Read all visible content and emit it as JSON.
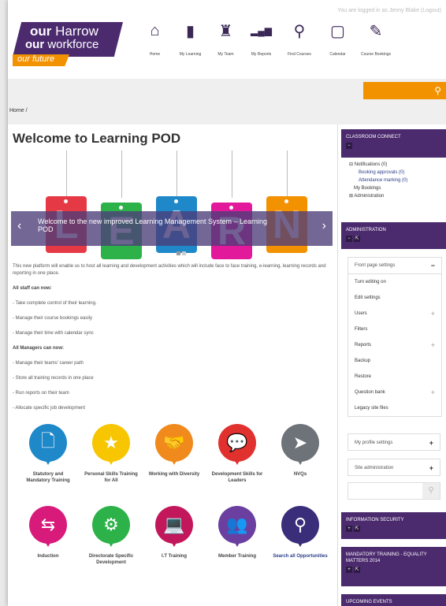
{
  "header": {
    "login_info": "You are logged in as Jenny Blake (Logout)",
    "logo": {
      "line1_bold": "our",
      "line1": "Harrow",
      "line2_bold": "our",
      "line2": "workforce",
      "line3": "our future"
    },
    "nav": [
      {
        "label": "Home",
        "icon": "home-icon",
        "glyph": "⌂"
      },
      {
        "label": "My Learning",
        "icon": "book-icon",
        "glyph": "▮"
      },
      {
        "label": "My Team",
        "icon": "team-icon",
        "glyph": "♜"
      },
      {
        "label": "My Reports",
        "icon": "bar-chart-icon",
        "glyph": "▂▄▆"
      },
      {
        "label": "Find Courses",
        "icon": "search-icon",
        "glyph": "⚲"
      },
      {
        "label": "Calendar",
        "icon": "calendar-icon",
        "glyph": "▢"
      },
      {
        "label": "Course Bookings",
        "icon": "edit-icon",
        "glyph": "✎"
      }
    ],
    "breadcrumb": "Home  /"
  },
  "main": {
    "title": "Welcome to Learning POD",
    "banner": {
      "letters": [
        "L",
        "E",
        "A",
        "R",
        "N"
      ],
      "letter_colors": [
        "#e63946",
        "#2db24a",
        "#1e88c9",
        "#e3199b",
        "#f39200"
      ],
      "caption": "Welcome to the new improved Learning Management System – Learning POD",
      "prev": "‹",
      "next": "›"
    },
    "intro": "This new platform will enable us to host all learning and development activities which will include face to face training, e-learning, learning records and reporting in one place.",
    "staff_heading": "All staff can now:",
    "staff_points": [
      "- Take complete control of their learning.",
      "- Manage their course bookings easily",
      "- Manage their time with calendar sync"
    ],
    "managers_heading": "All Managers can now:",
    "managers_points": [
      "- Manage their teams' career path",
      "- Store all training records in one place",
      "- Run reports on their team",
      "- Allocate specific job development"
    ],
    "tiles": [
      {
        "label": "Statutory and Mandatory Training",
        "color": "#1e88c9",
        "icon": "document-icon",
        "glyph": "🗋"
      },
      {
        "label": "Personal Skills Training for All",
        "color": "#f7c600",
        "icon": "star-icon",
        "glyph": "★"
      },
      {
        "label": "Working with Diversity",
        "color": "#f08a1c",
        "icon": "handshake-icon",
        "glyph": "🤝"
      },
      {
        "label": "Development Skills for Leaders",
        "color": "#e0312f",
        "icon": "speech-bubble-icon",
        "glyph": "💬"
      },
      {
        "label": "NVQs",
        "color": "#6d7378",
        "icon": "cursor-icon",
        "glyph": "➤"
      },
      {
        "label": "Induction",
        "color": "#d81b7a",
        "icon": "signpost-icon",
        "glyph": "⇆"
      },
      {
        "label": "Directorate Specific Development",
        "color": "#2db24a",
        "icon": "gear-icon",
        "glyph": "⚙"
      },
      {
        "label": "I.T Training",
        "color": "#c2185b",
        "icon": "laptop-icon",
        "glyph": "💻"
      },
      {
        "label": "Member Training",
        "color": "#6a3fa0",
        "icon": "group-icon",
        "glyph": "👥"
      },
      {
        "label": "Search all Opportunities",
        "color": "#3a2d7a",
        "icon": "search-icon",
        "glyph": "⚲"
      }
    ]
  },
  "sidebar": {
    "classroom": {
      "title": "CLASSROOM CONNECT",
      "items": [
        "Notifications (0)",
        "Booking approvals (0)",
        "Attendance marking (0)",
        "My Bookings",
        "Administration"
      ]
    },
    "administration": {
      "title": "ADMINISTRATION",
      "front_page": "Front page settings",
      "items": [
        {
          "label": "Turn editing on",
          "expand": ""
        },
        {
          "label": "Edit settings",
          "expand": ""
        },
        {
          "label": "Users",
          "expand": "+"
        },
        {
          "label": "Filters",
          "expand": ""
        },
        {
          "label": "Reports",
          "expand": "+"
        },
        {
          "label": "Backup",
          "expand": ""
        },
        {
          "label": "Restore",
          "expand": ""
        },
        {
          "label": "Question bank",
          "expand": "+"
        },
        {
          "label": "Legacy site files",
          "expand": ""
        }
      ],
      "my_profile": "My profile settings",
      "site_admin": "Site administration"
    },
    "info_security": "INFORMATION SECURITY",
    "mandatory": "MANDATORY TRAINING - EQUALITY MATTERS 2014",
    "upcoming": "UPCOMING EVENTS"
  }
}
